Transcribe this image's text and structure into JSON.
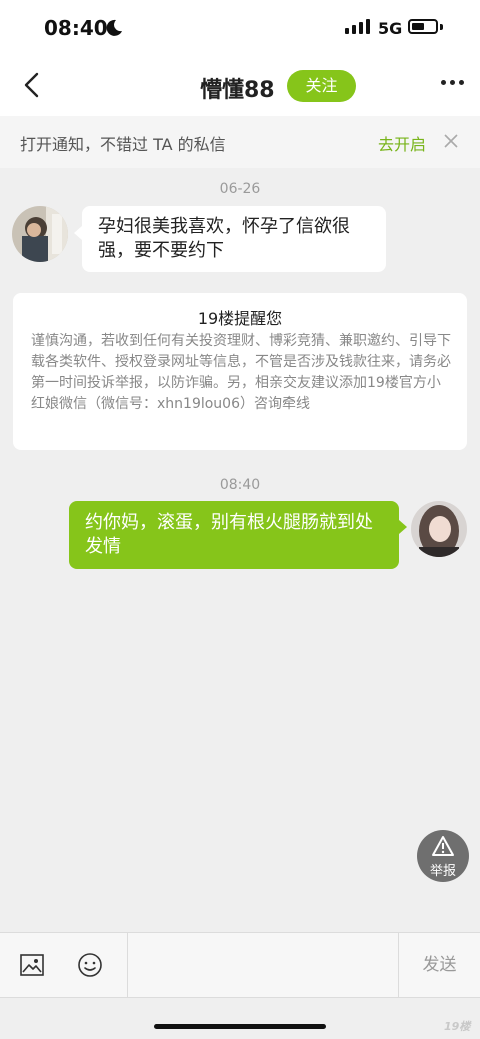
{
  "status_bar": {
    "time": "08:40",
    "network": "5G",
    "battery_level": 0.55
  },
  "header": {
    "title": "懵懂88",
    "follow_label": "关注"
  },
  "notification": {
    "text": "打开通知，不错过 TA 的私信",
    "action_label": "去开启"
  },
  "messages": [
    {
      "time": "06-26",
      "text": "孕妇很美我喜欢，怀孕了信欲很强，要不要约下",
      "direction": "incoming"
    },
    {
      "time": "08:40",
      "text": "约你妈，滚蛋，别有根火腿肠就到处发情",
      "direction": "outgoing"
    }
  ],
  "warning": {
    "title": "19楼提醒您",
    "body": "谨慎沟通，若收到任何有关投资理财、博彩竞猜、兼职邀约、引导下载各类软件、授权登录网址等信息，不管是否涉及钱款往来，请务必第一时间投诉举报，以防诈骗。另，相亲交友建议添加19楼官方小红娘微信（微信号：xhn19lou06）咨询牵线"
  },
  "report_label": "举报",
  "bottom": {
    "send_label": "发送",
    "input_value": ""
  },
  "watermark": "19楼",
  "colors": {
    "accent": "#86c51a",
    "link": "#78b41a",
    "background": "#efefef"
  },
  "icons": [
    "moon-icon",
    "signal-icon",
    "battery-icon",
    "back-icon",
    "more-icon",
    "close-icon",
    "warning-icon",
    "image-icon",
    "emoji-icon"
  ]
}
